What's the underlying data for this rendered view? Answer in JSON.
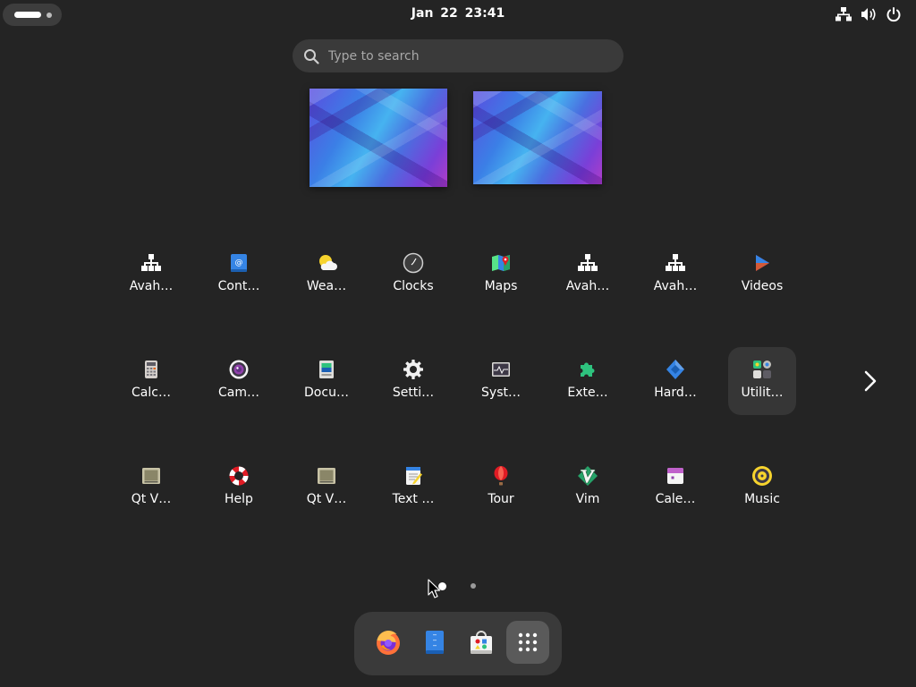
{
  "topbar": {
    "clock": "Jan 22  23:41",
    "icons": [
      "network-wired-icon",
      "volume-icon",
      "power-icon"
    ]
  },
  "search": {
    "placeholder": "Type to search"
  },
  "workspaces": [
    "workspace-1-thumbnail",
    "workspace-2-thumbnail"
  ],
  "apps": {
    "row1": [
      {
        "label": "Avah…",
        "icon": "network-icon"
      },
      {
        "label": "Cont…",
        "icon": "contacts-icon"
      },
      {
        "label": "Wea…",
        "icon": "weather-icon"
      },
      {
        "label": "Clocks",
        "icon": "clock-icon"
      },
      {
        "label": "Maps",
        "icon": "map-icon"
      },
      {
        "label": "Avah…",
        "icon": "network-icon"
      },
      {
        "label": "Avah…",
        "icon": "network-icon"
      },
      {
        "label": "Videos",
        "icon": "videos-icon"
      }
    ],
    "row2": [
      {
        "label": "Calc…",
        "icon": "calculator-icon"
      },
      {
        "label": "Cam…",
        "icon": "camera-icon"
      },
      {
        "label": "Docu…",
        "icon": "document-viewer-icon"
      },
      {
        "label": "Setti…",
        "icon": "settings-gear-icon"
      },
      {
        "label": "Syst…",
        "icon": "system-monitor-icon"
      },
      {
        "label": "Exte…",
        "icon": "extensions-puzzle-icon"
      },
      {
        "label": "Hard…",
        "icon": "hardware-icon"
      },
      {
        "label": "Utilit…",
        "icon": "utilities-folder-icon"
      }
    ],
    "row3": [
      {
        "label": "Qt V…",
        "icon": "qt-viewer-icon"
      },
      {
        "label": "Help",
        "icon": "help-lifebuoy-icon"
      },
      {
        "label": "Qt V…",
        "icon": "qt-viewer-icon"
      },
      {
        "label": "Text …",
        "icon": "text-editor-icon"
      },
      {
        "label": "Tour",
        "icon": "tour-balloon-icon"
      },
      {
        "label": "Vim",
        "icon": "vim-icon"
      },
      {
        "label": "Cale…",
        "icon": "calendar-icon"
      },
      {
        "label": "Music",
        "icon": "music-icon"
      }
    ]
  },
  "pagination": {
    "pages": 2,
    "current": 1
  },
  "dash": [
    "firefox-icon",
    "files-icon",
    "software-store-icon",
    "show-apps-grid-icon"
  ],
  "colors": {
    "background": "#242424",
    "panel": "#3a3a3a",
    "hover": "#363636"
  }
}
